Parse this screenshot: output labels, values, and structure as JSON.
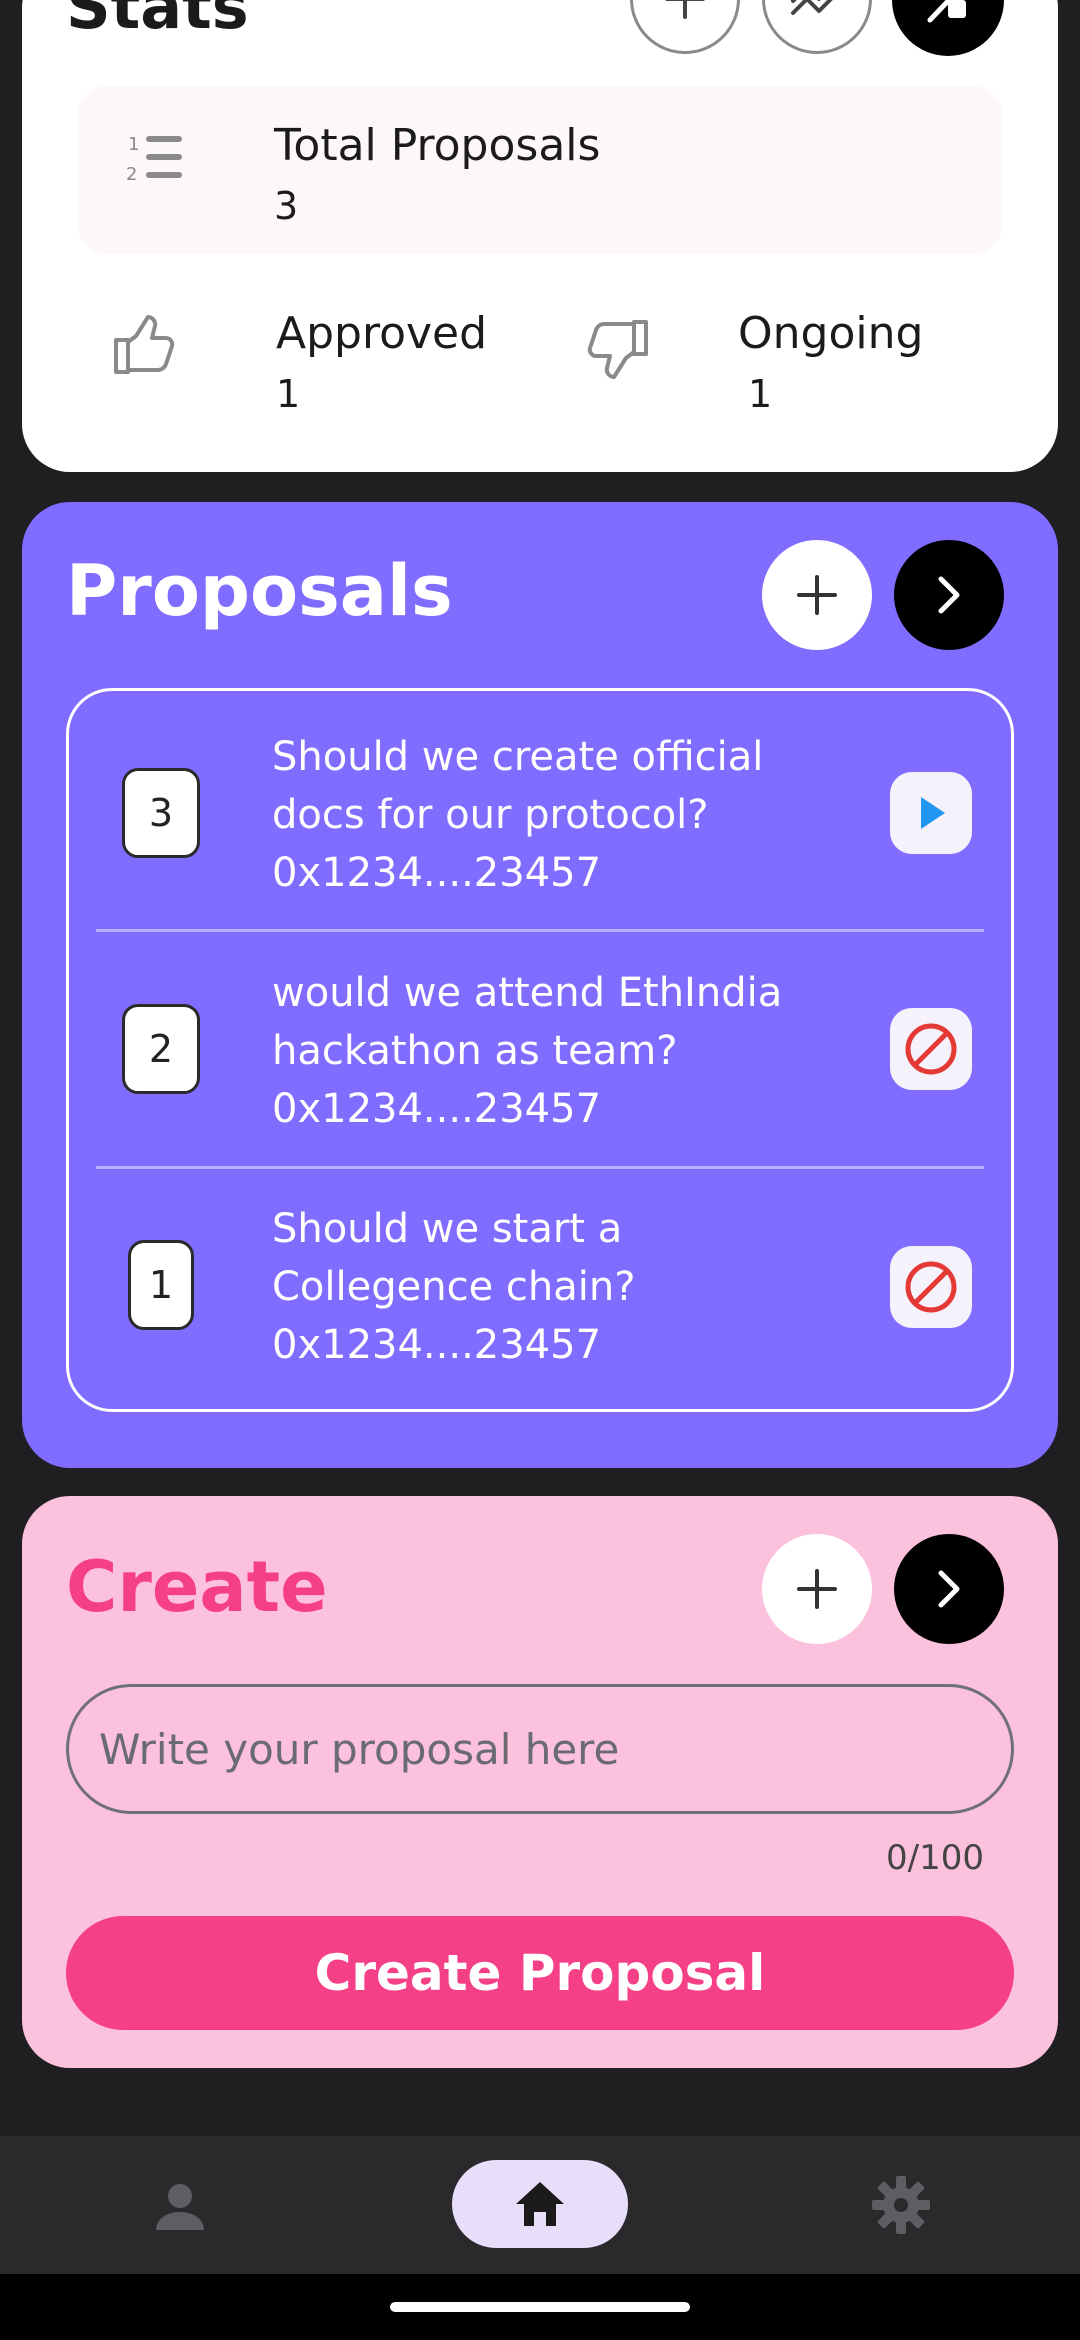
{
  "stats": {
    "title": "Stats",
    "total": {
      "label": "Total Proposals",
      "value": "3"
    },
    "approved": {
      "label": "Approved",
      "value": "1"
    },
    "ongoing": {
      "label": "Ongoing",
      "value": "1"
    }
  },
  "proposals": {
    "title": "Proposals",
    "items": [
      {
        "number": "3",
        "line1": "Should we create official",
        "line2": "docs for our protocol?",
        "address": "0x1234....23457",
        "status": "play-icon"
      },
      {
        "number": "2",
        "line1": "would we attend EthIndia",
        "line2": "hackathon as team?",
        "address": "0x1234....23457",
        "status": "blocked-icon"
      },
      {
        "number": "1",
        "line1": "Should we start a",
        "line2": "Collegence chain?",
        "address": "0x1234....23457",
        "status": "blocked-icon"
      }
    ]
  },
  "create": {
    "title": "Create",
    "input_placeholder": "Write your proposal here",
    "counter": "0/100",
    "button_label": "Create Proposal"
  },
  "nav": {
    "items": [
      "person-icon",
      "home-icon",
      "gear-icon"
    ],
    "active": "home-icon"
  },
  "colors": {
    "proposals_bg": "#806cff",
    "create_bg": "#fcc2dd",
    "create_accent": "#f53f86",
    "play_blue": "#2196f3",
    "blocked_red": "#e53935"
  }
}
